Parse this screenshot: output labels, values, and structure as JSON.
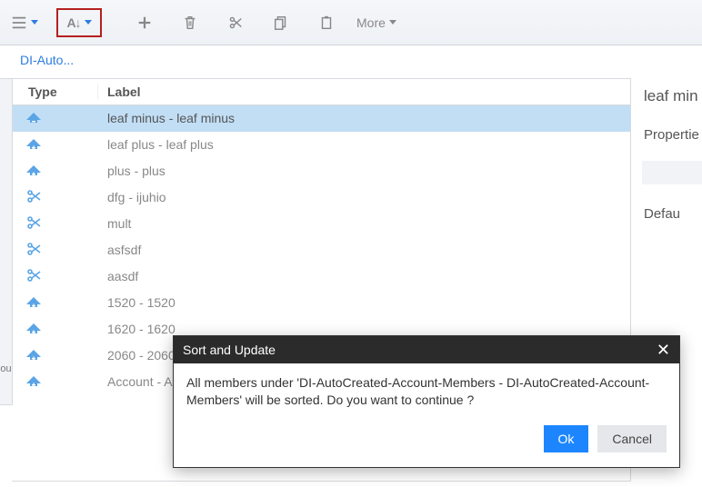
{
  "toolbar": {
    "sort_label": "A↓",
    "more_label": "More"
  },
  "breadcrumb": {
    "path": "DI-Auto..."
  },
  "table": {
    "headers": {
      "type": "Type",
      "label": "Label"
    },
    "rows": [
      {
        "icon": "leaf-minus",
        "label": "leaf minus - leaf minus",
        "selected": true
      },
      {
        "icon": "leaf-plus",
        "label": "leaf plus - leaf plus"
      },
      {
        "icon": "leaf-plus",
        "label": "plus - plus"
      },
      {
        "icon": "cut",
        "label": "dfg - ijuhio"
      },
      {
        "icon": "cut",
        "label": "mult"
      },
      {
        "icon": "cut",
        "label": "asfsdf"
      },
      {
        "icon": "cut",
        "label": "aasdf"
      },
      {
        "icon": "leaf-plus",
        "label": "1520 - 1520"
      },
      {
        "icon": "leaf-plus",
        "label": "1620 - 1620"
      },
      {
        "icon": "leaf-plus",
        "label": "2060 - 2060"
      },
      {
        "icon": "leaf-plus",
        "label": "Account - A"
      }
    ]
  },
  "side": {
    "title": "leaf min",
    "properties_label": "Propertie",
    "default_label": "Defau"
  },
  "dialog": {
    "title": "Sort and Update",
    "message": "All members under 'DI-AutoCreated-Account-Members - DI-AutoCreated-Account-Members' will be sorted. Do you want to continue ?",
    "ok": "Ok",
    "cancel": "Cancel"
  },
  "left_tab": {
    "label": "ou"
  }
}
